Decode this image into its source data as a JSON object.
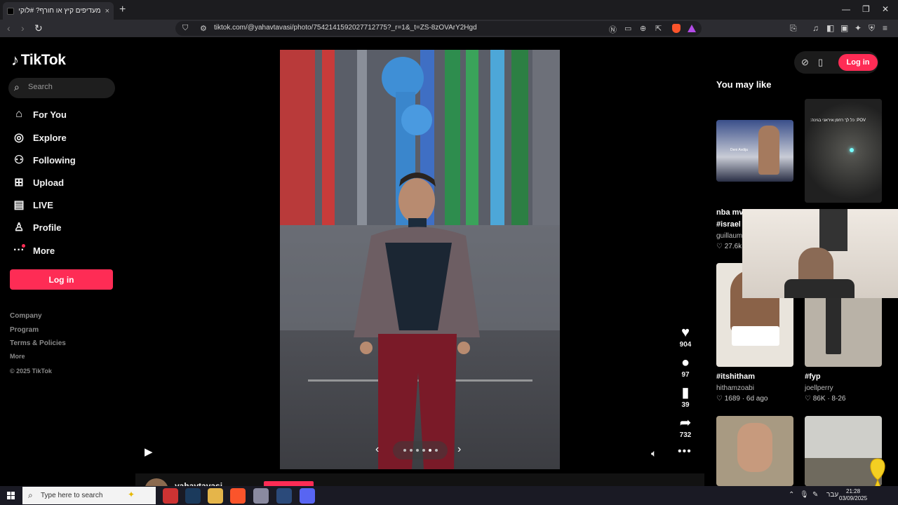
{
  "browser": {
    "tab_title": "מעדיפים קיץ או חורף? #לוקים #",
    "tab_close": "×",
    "new_tab": "+",
    "url": "tiktok.com/@yahavtavasi/photo/7542141592027712775?_r=1&_t=ZS-8zOVArY2Hgd"
  },
  "sidebar": {
    "logo": "TikTok",
    "search_placeholder": "Search",
    "items": [
      {
        "label": "For You",
        "icon": "home-icon"
      },
      {
        "label": "Explore",
        "icon": "compass-icon"
      },
      {
        "label": "Following",
        "icon": "following-icon"
      },
      {
        "label": "Upload",
        "icon": "upload-icon"
      },
      {
        "label": "LIVE",
        "icon": "live-icon"
      },
      {
        "label": "Profile",
        "icon": "profile-icon"
      },
      {
        "label": "More",
        "icon": "more-icon"
      }
    ],
    "login": "Log in",
    "footer": [
      "Company",
      "Program",
      "Terms & Policies",
      "More",
      "© 2025 TikTok"
    ]
  },
  "post": {
    "author": "yahavtavasi",
    "likes": "904",
    "comments": "97",
    "saves": "39",
    "shares": "732",
    "slide_count": 6,
    "current_slide": 4
  },
  "right": {
    "login": "Log in",
    "you_may_like": "You may like",
    "cards": [
      {
        "caption": "nba mv",
        "sub": "#israel",
        "author": "guillaum",
        "meta": "27.6k"
      },
      {
        "caption": "",
        "sub": "",
        "author": "",
        "meta": ""
      },
      {
        "caption": "#itshitham",
        "sub": "",
        "author": "hithamzoabi",
        "meta": "1689 · 6d ago"
      },
      {
        "caption": "#fyp",
        "sub": "",
        "author": "joellperry",
        "meta": "86K · 8-26"
      }
    ],
    "thumb_texts": [
      "Deni Avdija",
      "POV: כל לך רחפן איראני בגינה:"
    ]
  },
  "taskbar": {
    "search_placeholder": "Type here to search",
    "time": "21:28",
    "date": "03/09/2025",
    "lang": "עבר"
  },
  "colors": {
    "accent": "#fe2c55",
    "background": "#000000"
  }
}
